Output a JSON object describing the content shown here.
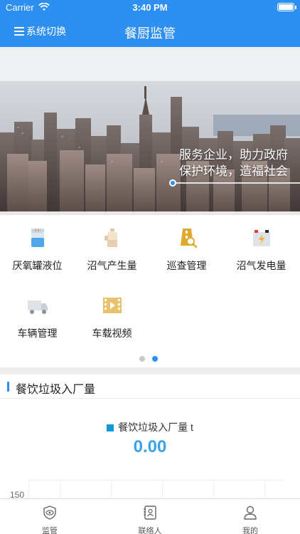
{
  "status": {
    "carrier": "Carrier",
    "time": "3:40 PM"
  },
  "header": {
    "switch_label": "系统切换",
    "title": "餐厨监管"
  },
  "banner": {
    "line1": "服务企业，助力政府",
    "line2": "保护环境，造福社会"
  },
  "grid": {
    "items": [
      {
        "label": "厌氧罐液位",
        "icon": "tank-icon"
      },
      {
        "label": "沼气产生量",
        "icon": "gas-bottle-icon"
      },
      {
        "label": "巡查管理",
        "icon": "inspection-icon"
      },
      {
        "label": "沼气发电量",
        "icon": "battery-power-icon"
      },
      {
        "label": "车辆管理",
        "icon": "truck-icon"
      },
      {
        "label": "车载视频",
        "icon": "video-icon"
      }
    ]
  },
  "pager": {
    "pages": 2,
    "current": 2
  },
  "section": {
    "title": "餐饮垃圾入厂量"
  },
  "chart": {
    "legend": "餐饮垃圾入厂量 t",
    "value": "0.00",
    "y_tick": "150"
  },
  "chart_data": {
    "type": "line",
    "title": "",
    "series": [
      {
        "name": "餐饮垃圾入厂量 t",
        "values": []
      }
    ],
    "yticks": [
      150
    ],
    "accent": "#1296db"
  },
  "tabbar": {
    "tabs": [
      {
        "label": "监管"
      },
      {
        "label": "联络人"
      },
      {
        "label": "我的"
      }
    ]
  },
  "colors": {
    "primary": "#2d8ff0",
    "value": "#3aa4e8"
  }
}
